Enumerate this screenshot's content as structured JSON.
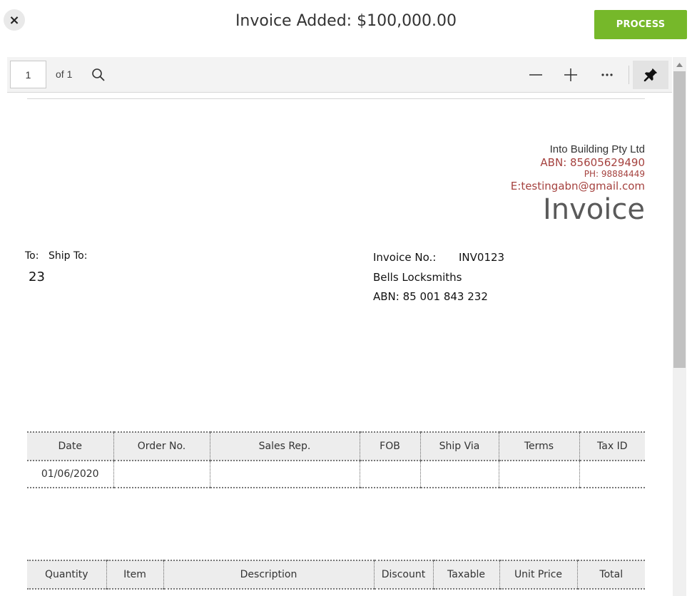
{
  "modal": {
    "title": "Invoice Added: $100,000.00",
    "close_label": "×",
    "process_label": "PROCESS",
    "accent_color": "#76b82a"
  },
  "viewer": {
    "page_current": "1",
    "page_of": "of 1",
    "icons": [
      "search-icon",
      "zoom-out-icon",
      "zoom-in-icon",
      "more-icon",
      "pin-icon"
    ]
  },
  "invoice": {
    "company_name": "Into Building Pty Ltd",
    "company_abn": "ABN: 85605629490",
    "company_phone": "PH: 98884449",
    "company_email": "E:testingabn@gmail.com",
    "doc_title": "Invoice",
    "to_label": "To:",
    "ship_to_label": "Ship To:",
    "to_value": "23",
    "invoice_no_label": "Invoice No.:",
    "invoice_no_value": "INV0123",
    "customer_name": "Bells Locksmiths",
    "customer_abn": "ABN: 85 001 843 232",
    "brand_color": "#a5423f"
  },
  "order_table": {
    "headers": [
      "Date",
      "Order No.",
      "Sales Rep.",
      "FOB",
      "Ship Via",
      "Terms",
      "Tax ID"
    ],
    "rows": [
      [
        "01/06/2020",
        "",
        "",
        "",
        "",
        "",
        ""
      ]
    ]
  },
  "items_table": {
    "headers": [
      "Quantity",
      "Item",
      "Description",
      "Discount",
      "Taxable",
      "Unit Price",
      "Total"
    ]
  }
}
